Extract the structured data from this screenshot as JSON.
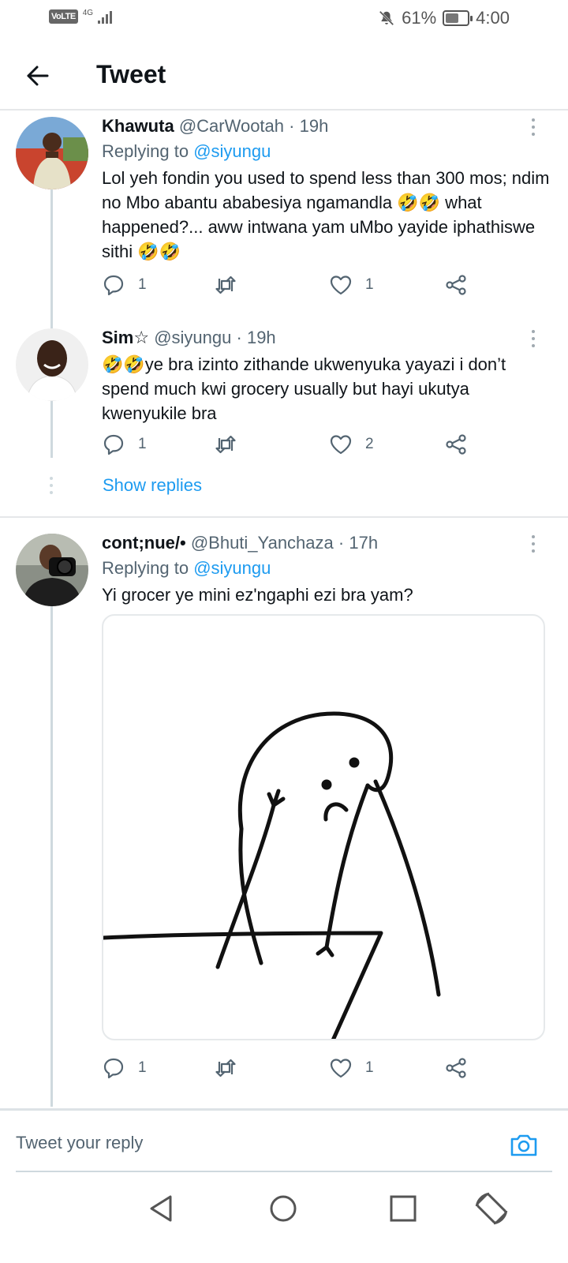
{
  "status_bar": {
    "volte": "VoLTE",
    "network": "4G",
    "battery": "61%",
    "battery_level": 0.61,
    "time": "4:00"
  },
  "header": {
    "title": "Tweet"
  },
  "tweets": [
    {
      "name": "Khawuta",
      "handle": "@CarWootah",
      "time": "19h",
      "replying_prefix": "Replying to",
      "replying_to": "@siyungu",
      "text": "Lol yeh fondin you used to spend less than 300 mos; ndim no Mbo abantu ababesiya ngamandla 🤣🤣 what happened?... aww intwana yam uMbo yayide iphathiswe sithi 🤣🤣",
      "replies": "1",
      "retweets": "",
      "likes": "1"
    },
    {
      "name": "Sim☆",
      "handle": "@siyungu",
      "time": "19h",
      "text": "🤣🤣ye bra izinto zithande ukwenyuka yayazi i don’t spend much kwi grocery usually but hayi ukutya kwenyukile bra",
      "replies": "1",
      "retweets": "",
      "likes": "2",
      "show_replies": "Show replies"
    },
    {
      "name": "cont;nue/•",
      "handle": "@Bhuti_Yanchaza",
      "time": "17h",
      "replying_prefix": "Replying to",
      "replying_to": "@siyungu",
      "text": "Yi grocer ye mini ez'ngaphi ezi bra yam?",
      "replies": "1",
      "retweets": "",
      "likes": "1"
    }
  ],
  "reply_bar": {
    "placeholder": "Tweet your reply"
  },
  "colors": {
    "accent": "#1d9bf0",
    "secondary_text": "#536471",
    "divider": "#e5e7e9"
  },
  "icons": [
    "back-arrow-icon",
    "reply-icon",
    "retweet-icon",
    "like-icon",
    "share-icon",
    "more-icon",
    "camera-icon",
    "nav-back-icon",
    "nav-home-icon",
    "nav-recents-icon",
    "rotate-icon"
  ]
}
